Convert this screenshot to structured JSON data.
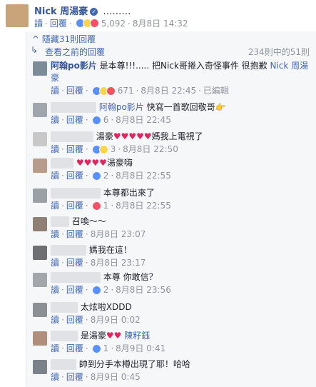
{
  "top_comment": {
    "author": "Nick 周湯豪",
    "text": "………",
    "actions": {
      "read": "讀",
      "reply": "回覆"
    },
    "reaction_count": "5,092",
    "time": "8月8日 14:32"
  },
  "thread": {
    "hide_label": "隱藏31則回覆",
    "prev_label": "查看之前的回覆",
    "page_count": "234則中的51則"
  },
  "replies": [
    {
      "author": "阿翰po影片",
      "text": "是本尊!!!..... 把Nick哥捲入奇怪事件 很抱歉",
      "mention": "Nick 周湯豪",
      "read": "讀",
      "reply": "回覆",
      "reactions": [
        "like",
        "haha",
        "love"
      ],
      "count": "671",
      "time": "8月8日 22:45",
      "edited": "已編輯"
    },
    {
      "author": "",
      "mention": "阿翰po影片",
      "text": "快寫一首歌回敬哥👉",
      "read": "讀",
      "reply": "回覆",
      "reactions": [
        "like"
      ],
      "count": "6",
      "time": "8月8日 22:45"
    },
    {
      "author": "",
      "text": "湯豪❤❤❤❤❤媽我上電視了",
      "read": "讀",
      "reply": "回覆",
      "reactions": [
        "like",
        "wow"
      ],
      "count": "3",
      "time": "8月8日 22:50"
    },
    {
      "author": "",
      "text": "❤❤❤❤湯豪嗨",
      "read": "讀",
      "reply": "回覆",
      "reactions": [
        "like"
      ],
      "count": "2",
      "time": "8月8日 22:55"
    },
    {
      "author": "",
      "text": "本尊都出來了",
      "read": "讀",
      "reply": "回覆",
      "reactions": [
        "love"
      ],
      "count": "1",
      "time": "8月8日 22:55"
    },
    {
      "author": "",
      "text": "召喚～～",
      "read": "讀",
      "reply": "回覆",
      "reactions": [],
      "count": "",
      "time": "8月8日 23:07"
    },
    {
      "author": "",
      "text": "媽我在這！",
      "read": "讀",
      "reply": "回覆",
      "reactions": [],
      "count": "",
      "time": "8月8日 23:17"
    },
    {
      "author": "",
      "text": "本尊 你敢信？",
      "read": "讀",
      "reply": "回覆",
      "reactions": [
        "like"
      ],
      "count": "2",
      "time": "8月8日 23:56"
    },
    {
      "author": "",
      "text": "太炫啦XDDD",
      "read": "讀",
      "reply": "回覆",
      "reactions": [],
      "count": "",
      "time": "8月9日 0:02"
    },
    {
      "author": "",
      "text": "是湯豪❤❤",
      "mention": "陳籽鈺",
      "read": "讀",
      "reply": "回覆",
      "reactions": [
        "like"
      ],
      "count": "1",
      "time": "8月9日 0:41"
    },
    {
      "author": "",
      "text": "帥到分手本樽出現了耶！哈哈",
      "read": "讀",
      "reply": "回覆",
      "reactions": [],
      "count": "",
      "time": "8月9日 0:45"
    }
  ]
}
